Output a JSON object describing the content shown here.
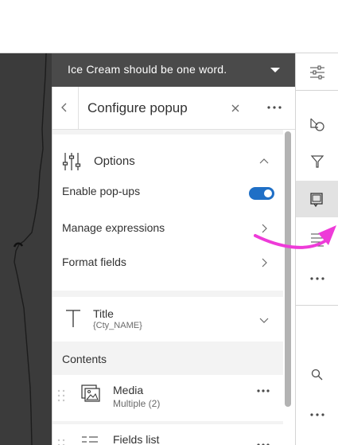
{
  "banner": {
    "text": "Ice Cream should be one word."
  },
  "panel": {
    "title": "Configure popup",
    "options": {
      "heading": "Options",
      "enable_popups": "Enable pop-ups",
      "manage_expressions": "Manage expressions",
      "format_fields": "Format fields"
    },
    "title_section": {
      "label": "Title",
      "value": "{Cty_NAME}"
    },
    "contents": {
      "heading": "Contents",
      "items": [
        {
          "label": "Media",
          "sub": "Multiple (2)"
        },
        {
          "label": "Fields list",
          "sub": ""
        }
      ]
    }
  },
  "rail": {
    "icons": [
      "settings-sliders-icon",
      "shapes-icon",
      "filter-icon",
      "popup-icon",
      "list-icon",
      "more-icon",
      "search-icon",
      "more-icon"
    ]
  },
  "colors": {
    "accent": "#1f6fc6",
    "annotation": "#ee3bd8",
    "banner": "#4a4a4a",
    "map": "#3b3b3b"
  }
}
